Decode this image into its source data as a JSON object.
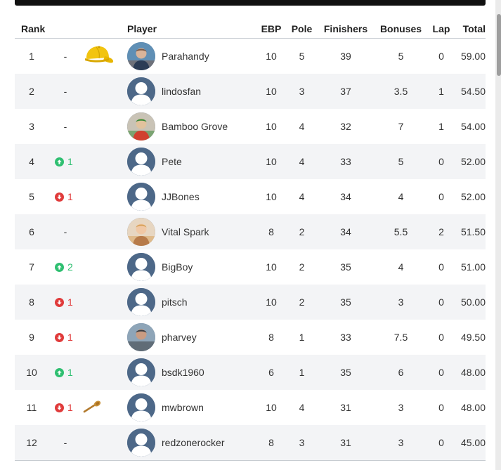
{
  "columns": {
    "rank": "Rank",
    "player": "Player",
    "ebp": "EBP",
    "pole": "Pole",
    "finishers": "Finishers",
    "bonuses": "Bonuses",
    "lap": "Lap",
    "total": "Total"
  },
  "colors": {
    "movement_up": "#2fbf71",
    "movement_down": "#e03b3b",
    "cap_badge": "#f2c40f",
    "spoon_badge": "#c8923a",
    "default_avatar": "#4d6888"
  },
  "rows": [
    {
      "rank": "1",
      "movement": "-",
      "movement_dir": "none",
      "badge": "yellow-cap-icon",
      "avatar": "photo",
      "player": "Parahandy",
      "ebp": "10",
      "pole": "5",
      "finishers": "39",
      "bonuses": "5",
      "lap": "0",
      "total": "59.00"
    },
    {
      "rank": "2",
      "movement": "-",
      "movement_dir": "none",
      "badge": "",
      "avatar": "default",
      "player": "lindosfan",
      "ebp": "10",
      "pole": "3",
      "finishers": "37",
      "bonuses": "3.5",
      "lap": "1",
      "total": "54.50"
    },
    {
      "rank": "3",
      "movement": "-",
      "movement_dir": "none",
      "badge": "",
      "avatar": "photo",
      "player": "Bamboo Grove",
      "ebp": "10",
      "pole": "4",
      "finishers": "32",
      "bonuses": "7",
      "lap": "1",
      "total": "54.00"
    },
    {
      "rank": "4",
      "movement": "1",
      "movement_dir": "up",
      "badge": "",
      "avatar": "default",
      "player": "Pete",
      "ebp": "10",
      "pole": "4",
      "finishers": "33",
      "bonuses": "5",
      "lap": "0",
      "total": "52.00"
    },
    {
      "rank": "5",
      "movement": "1",
      "movement_dir": "down",
      "badge": "",
      "avatar": "default",
      "player": "JJBones",
      "ebp": "10",
      "pole": "4",
      "finishers": "34",
      "bonuses": "4",
      "lap": "0",
      "total": "52.00"
    },
    {
      "rank": "6",
      "movement": "-",
      "movement_dir": "none",
      "badge": "",
      "avatar": "photo",
      "player": "Vital Spark",
      "ebp": "8",
      "pole": "2",
      "finishers": "34",
      "bonuses": "5.5",
      "lap": "2",
      "total": "51.50"
    },
    {
      "rank": "7",
      "movement": "2",
      "movement_dir": "up",
      "badge": "",
      "avatar": "default",
      "player": "BigBoy",
      "ebp": "10",
      "pole": "2",
      "finishers": "35",
      "bonuses": "4",
      "lap": "0",
      "total": "51.00"
    },
    {
      "rank": "8",
      "movement": "1",
      "movement_dir": "down",
      "badge": "",
      "avatar": "default",
      "player": "pitsch",
      "ebp": "10",
      "pole": "2",
      "finishers": "35",
      "bonuses": "3",
      "lap": "0",
      "total": "50.00"
    },
    {
      "rank": "9",
      "movement": "1",
      "movement_dir": "down",
      "badge": "",
      "avatar": "photo",
      "player": "pharvey",
      "ebp": "8",
      "pole": "1",
      "finishers": "33",
      "bonuses": "7.5",
      "lap": "0",
      "total": "49.50"
    },
    {
      "rank": "10",
      "movement": "1",
      "movement_dir": "up",
      "badge": "",
      "avatar": "default",
      "player": "bsdk1960",
      "ebp": "6",
      "pole": "1",
      "finishers": "35",
      "bonuses": "6",
      "lap": "0",
      "total": "48.00"
    },
    {
      "rank": "11",
      "movement": "1",
      "movement_dir": "down",
      "badge": "wooden-spoon-icon",
      "avatar": "default",
      "player": "mwbrown",
      "ebp": "10",
      "pole": "4",
      "finishers": "31",
      "bonuses": "3",
      "lap": "0",
      "total": "48.00"
    },
    {
      "rank": "12",
      "movement": "-",
      "movement_dir": "none",
      "badge": "",
      "avatar": "default",
      "player": "redzonerocker",
      "ebp": "8",
      "pole": "3",
      "finishers": "31",
      "bonuses": "3",
      "lap": "0",
      "total": "45.00"
    }
  ]
}
